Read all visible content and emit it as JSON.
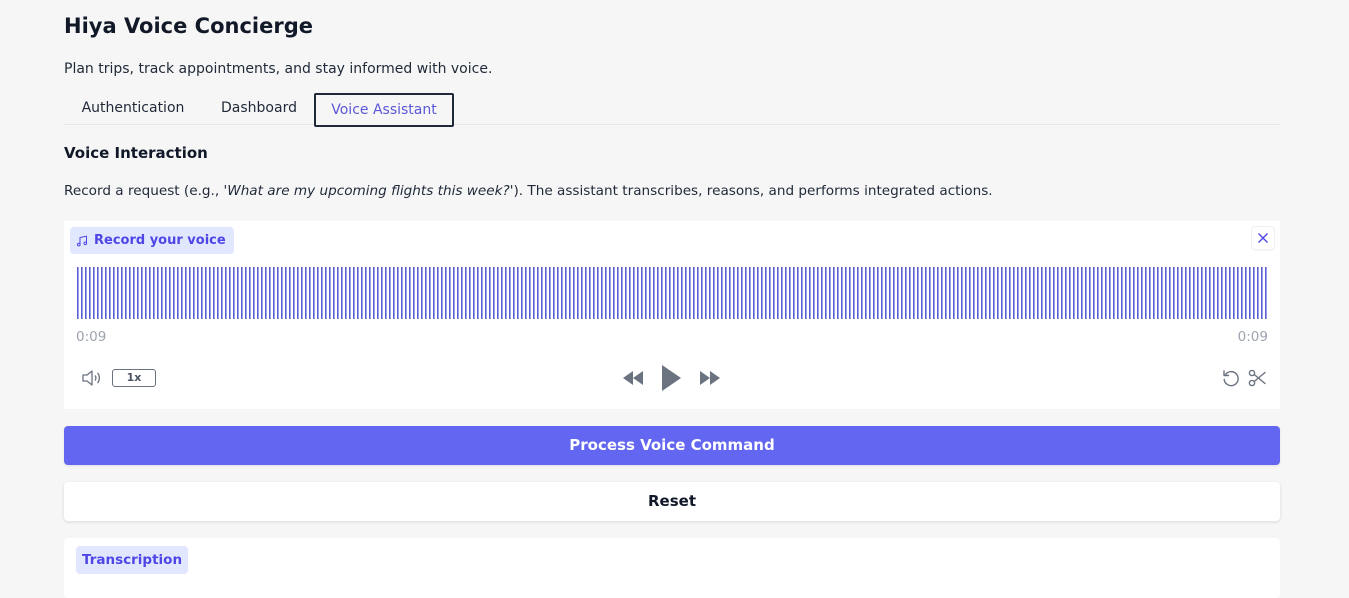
{
  "app": {
    "title": "Hiya Voice Concierge",
    "subtitle": "Plan trips, track appointments, and stay informed with voice."
  },
  "tabs": [
    {
      "label": "Authentication",
      "active": false
    },
    {
      "label": "Dashboard",
      "active": false
    },
    {
      "label": "Voice Assistant",
      "active": true
    }
  ],
  "section": {
    "title": "Voice Interaction",
    "desc_prefix": "Record a request (e.g., ",
    "desc_example": "'What are my upcoming flights this week?'",
    "desc_suffix": "). The assistant transcribes, reasons, and performs integrated actions."
  },
  "audio": {
    "label": "Record your voice",
    "label_icon": "music-note-icon",
    "time_current": "0:09",
    "time_total": "0:09",
    "speed": "1x",
    "progress": 1.0,
    "icons": [
      "volume-icon",
      "rewind-icon",
      "play-icon",
      "fast-forward-icon",
      "undo-icon",
      "scissors-icon",
      "close-icon"
    ]
  },
  "buttons": {
    "process": "Process Voice Command",
    "reset": "Reset"
  },
  "transcription": {
    "label": "Transcription"
  },
  "colors": {
    "accent": "#6366f1",
    "chip_bg": "#e0e7ff",
    "chip_text": "#4f46e5",
    "waveform": "#5b5fd4",
    "icon_gray": "#6b7280"
  }
}
